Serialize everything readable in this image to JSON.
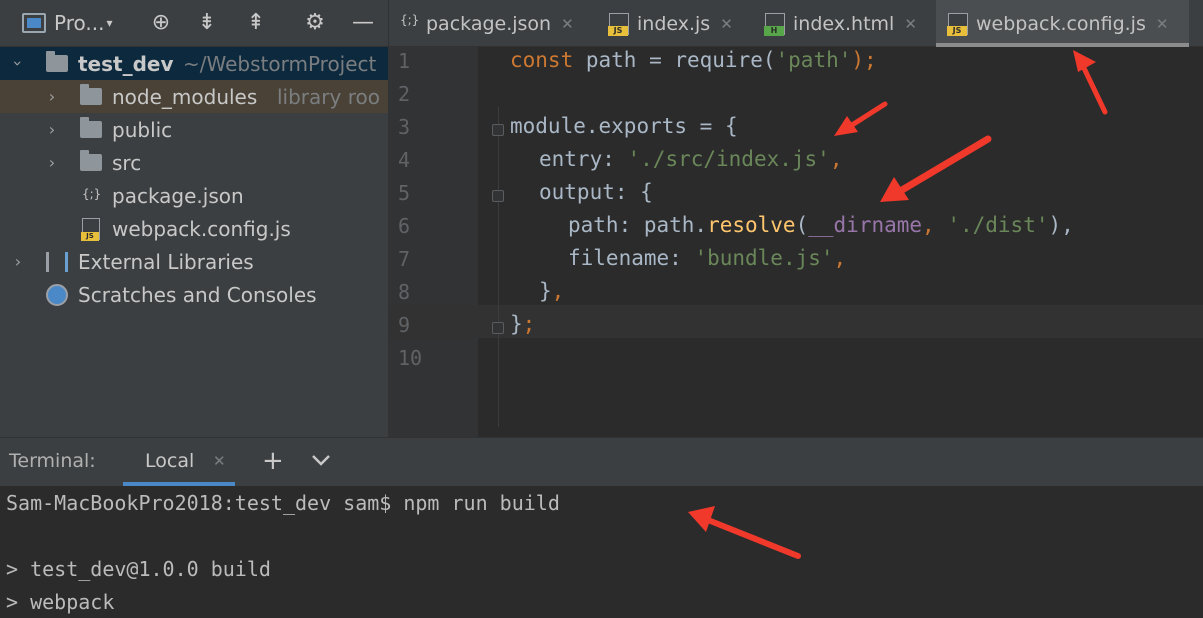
{
  "toolbar": {
    "project_switch": "Pro...",
    "caret": "▾",
    "locate_icon": "⊕",
    "expand_icon": "⇟",
    "collapse_icon": "⇞",
    "gear_icon": "⚙",
    "minimize_icon": "—"
  },
  "tabs": [
    {
      "label": "package.json",
      "type": "json"
    },
    {
      "label": "index.js",
      "type": "js"
    },
    {
      "label": "index.html",
      "type": "html"
    },
    {
      "label": "webpack.config.js",
      "type": "js",
      "active": true
    }
  ],
  "close_glyph": "✕",
  "tree": {
    "root_name": "test_dev",
    "root_path": "~/WebstormProject",
    "items": [
      {
        "label": "node_modules",
        "note": "library roo"
      },
      {
        "label": "public"
      },
      {
        "label": "src"
      },
      {
        "label": "package.json"
      },
      {
        "label": "webpack.config.js"
      }
    ],
    "external": "External Libraries",
    "scratches": "Scratches and Consoles"
  },
  "editor": {
    "line_numbers": [
      "1",
      "2",
      "3",
      "4",
      "5",
      "6",
      "7",
      "8",
      "9",
      "10"
    ],
    "current_line": 9,
    "l1": {
      "kw": "const",
      "rest": " path = require(",
      "str": "'path'",
      "end": ");"
    },
    "l3": {
      "obj": "module.",
      "prop": "exports",
      "rest": " = {"
    },
    "l4": {
      "key": "entry:",
      "str": "'./src/index.js'",
      "end": ","
    },
    "l5": {
      "key": "output:",
      "rest": " {"
    },
    "l6": {
      "key": "path:",
      "obj": " path.",
      "fn": "resolve",
      "open": "(",
      "prop": "__dirname",
      "comma": ",",
      "str": " './dist'",
      "end": "),"
    },
    "l7": {
      "key": "filename:",
      "str": " 'bundle.js'",
      "end": ","
    },
    "l8": {
      "brace": "}",
      "end": ","
    },
    "l9": {
      "brace": "}",
      "end": ";"
    }
  },
  "terminal": {
    "title": "Terminal:",
    "tab": "Local",
    "plus": "+",
    "lines": [
      "Sam-MacBookPro2018:test_dev sam$ npm run build",
      "",
      "> test_dev@1.0.0 build",
      "> webpack"
    ]
  },
  "colors": {
    "annotation": "#f0392b",
    "keyword": "#cc7832",
    "string": "#6a8759",
    "property": "#9876aa",
    "function": "#ffc66d"
  }
}
